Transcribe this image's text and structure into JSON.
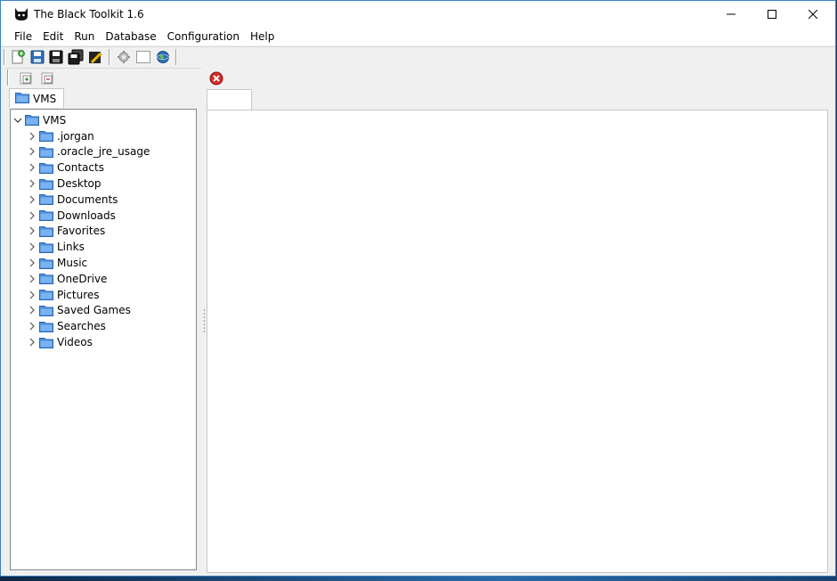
{
  "window": {
    "title": "The Black Toolkit 1.6",
    "icons": {
      "app": "black-cat-icon",
      "minimize": "minimize-icon",
      "maximize": "maximize-icon",
      "close": "close-icon"
    }
  },
  "menubar": {
    "items": [
      "File",
      "Edit",
      "Run",
      "Database",
      "Configuration",
      "Help"
    ]
  },
  "toolbar": {
    "icons": [
      "new-file-icon",
      "save-icon",
      "save-as-icon",
      "save-all-icon",
      "edit-document-icon",
      "gear-icon",
      "blank-window-icon",
      "globe-icon"
    ]
  },
  "left_panel": {
    "toolbar_icons": [
      "expand-all-icon",
      "collapse-all-icon"
    ],
    "tab_label": "VMS",
    "tree": {
      "root": "VMS",
      "children": [
        ".jorgan",
        ".oracle_jre_usage",
        "Contacts",
        "Desktop",
        "Documents",
        "Downloads",
        "Favorites",
        "Links",
        "Music",
        "OneDrive",
        "Pictures",
        "Saved Games",
        "Searches",
        "Videos"
      ]
    }
  },
  "right_panel": {
    "close_icon": "red-close-icon",
    "tab_label": ""
  },
  "colors": {
    "folder": "#4a90e2",
    "close_red": "#d42a2a",
    "accent": "#3a82c4"
  }
}
